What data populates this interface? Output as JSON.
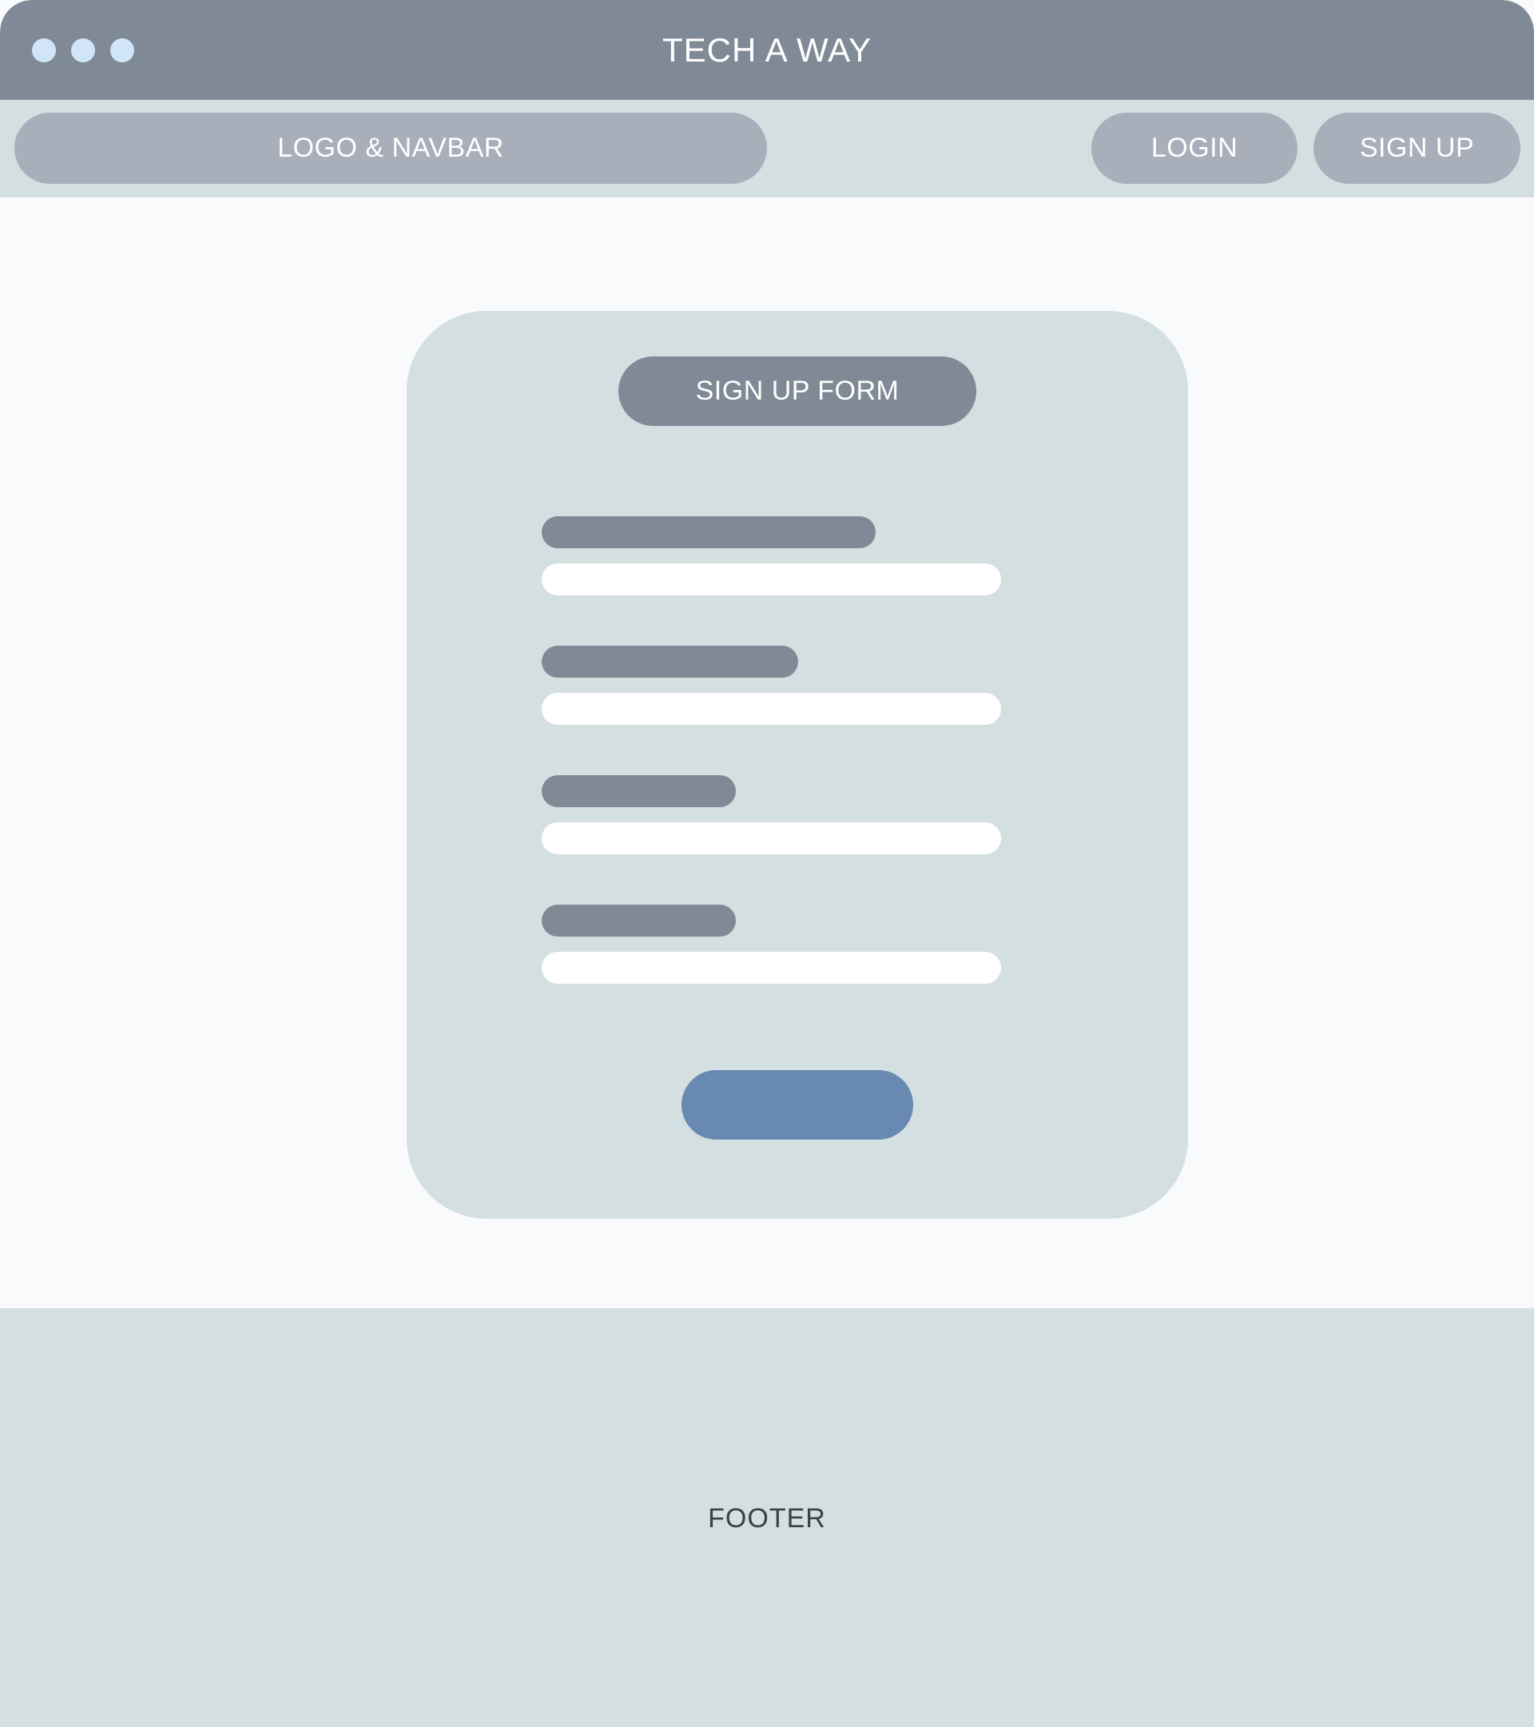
{
  "window": {
    "title": "TECH A WAY"
  },
  "navbar": {
    "logo_label": "LOGO & NAVBAR",
    "login_label": "LOGIN",
    "signup_label": "SIGN UP"
  },
  "form": {
    "title": "SIGN UP FORM",
    "field_count": 4,
    "submit_label": ""
  },
  "footer": {
    "label": "FOOTER"
  },
  "colors": {
    "titlebar": "#808a96",
    "navbar_bg": "#d4dfe1",
    "pill": "#a8afba",
    "card": "#d4dfe1",
    "label_placeholder": "#808a96",
    "input": "#ffffff",
    "submit": "#6889b1",
    "window_dots": "#d0e5f7",
    "page_bg": "#f8fafc"
  }
}
